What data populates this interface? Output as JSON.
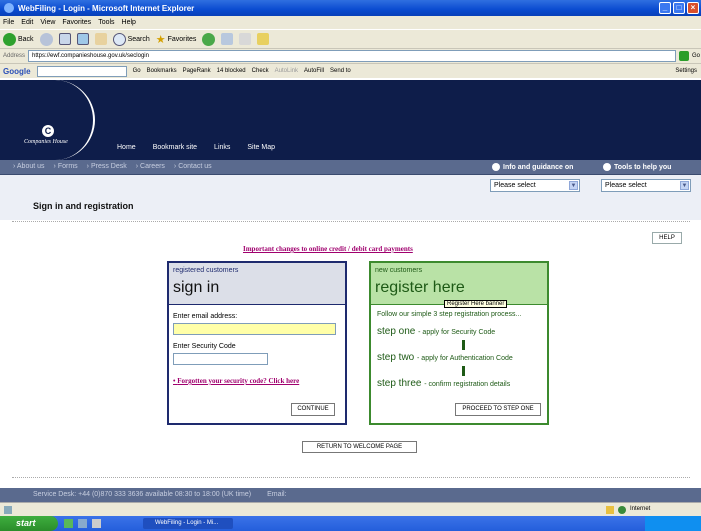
{
  "window": {
    "title": "WebFiling - Login - Microsoft Internet Explorer"
  },
  "menu": [
    "File",
    "Edit",
    "View",
    "Favorites",
    "Tools",
    "Help"
  ],
  "toolbar": {
    "back_label": "Back",
    "search_label": "Search",
    "favorites_label": "Favorites"
  },
  "address": {
    "label": "Address",
    "url": "https://ewf.companieshouse.gov.uk/seclogin",
    "go_label": "Go"
  },
  "googlebar": {
    "brand": "Google",
    "go_label": "Go",
    "bookmarks": "Bookmarks",
    "pagerank": "PageRank",
    "blocked": "14 blocked",
    "check": "Check",
    "autolink": "AutoLink",
    "autofill": "AutoFill",
    "sendto": "Send to",
    "settings": "Settings"
  },
  "site": {
    "logo_text": "Companies House",
    "nav": [
      "Home",
      "Bookmark site",
      "Links",
      "Site Map"
    ],
    "subnav": [
      "About us",
      "Forms",
      "Press Desk",
      "Careers",
      "Contact us"
    ],
    "info_guidance": "Info and guidance on",
    "tools_help": "Tools to help you",
    "select_1": "Please select",
    "select_2": "Please select",
    "page_title": "Sign in and registration",
    "help_label": "HELP",
    "notice": "Important changes to online credit / debit card payments"
  },
  "signin": {
    "small": "registered customers",
    "big": "sign in",
    "email_label": "Enter email address:",
    "code_label": "Enter Security Code",
    "forgot": "Forgotten your security code? Click here",
    "continue": "CONTINUE"
  },
  "register": {
    "small": "new customers",
    "big": "register here",
    "tooltip": "Register Here banner",
    "intro": "Follow our simple 3 step registration process...",
    "step1_title": "step one",
    "step1_desc": "- apply for Security Code",
    "step2_title": "step two",
    "step2_desc": "- apply for Authentication Code",
    "step3_title": "step three",
    "step3_desc": "- confirm registration details",
    "proceed": "PROCEED TO STEP ONE"
  },
  "return_label": "RETURN TO WELCOME PAGE",
  "footer": {
    "service_desk": "Service Desk: +44 (0)870 333 3636 available 08:30 to 18:00 (UK time)",
    "email": "Email:"
  },
  "status": {
    "zone": "Internet"
  },
  "taskbar": {
    "start": "start",
    "item": "WebFiling - Login - Mi..."
  }
}
